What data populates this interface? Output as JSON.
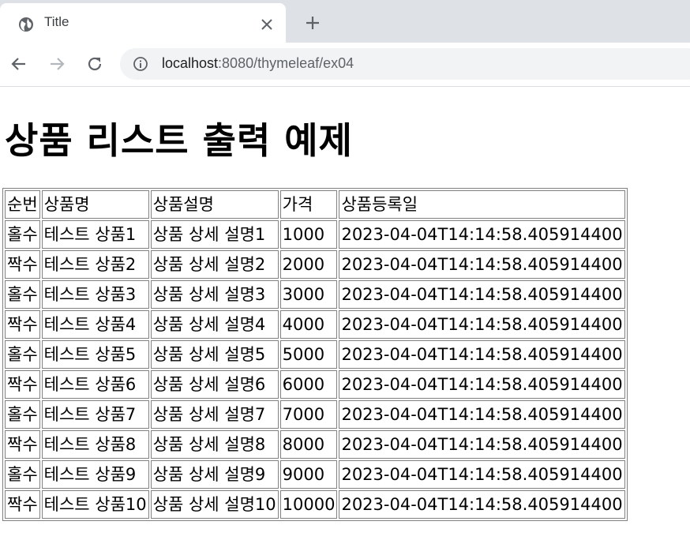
{
  "browser": {
    "tab_title": "Title",
    "url_host": "localhost",
    "url_rest": ":8080/thymeleaf/ex04"
  },
  "page": {
    "heading": "상품 리스트 출력 예제",
    "table": {
      "headers": [
        "순번",
        "상품명",
        "상품설명",
        "가격",
        "상품등록일"
      ],
      "rows": [
        [
          "홀수",
          "테스트 상품1",
          "상품 상세 설명1",
          "1000",
          "2023-04-04T14:14:58.405914400"
        ],
        [
          "짝수",
          "테스트 상품2",
          "상품 상세 설명2",
          "2000",
          "2023-04-04T14:14:58.405914400"
        ],
        [
          "홀수",
          "테스트 상품3",
          "상품 상세 설명3",
          "3000",
          "2023-04-04T14:14:58.405914400"
        ],
        [
          "짝수",
          "테스트 상품4",
          "상품 상세 설명4",
          "4000",
          "2023-04-04T14:14:58.405914400"
        ],
        [
          "홀수",
          "테스트 상품5",
          "상품 상세 설명5",
          "5000",
          "2023-04-04T14:14:58.405914400"
        ],
        [
          "짝수",
          "테스트 상품6",
          "상품 상세 설명6",
          "6000",
          "2023-04-04T14:14:58.405914400"
        ],
        [
          "홀수",
          "테스트 상품7",
          "상품 상세 설명7",
          "7000",
          "2023-04-04T14:14:58.405914400"
        ],
        [
          "짝수",
          "테스트 상품8",
          "상품 상세 설명8",
          "8000",
          "2023-04-04T14:14:58.405914400"
        ],
        [
          "홀수",
          "테스트 상품9",
          "상품 상세 설명9",
          "9000",
          "2023-04-04T14:14:58.405914400"
        ],
        [
          "짝수",
          "테스트 상품10",
          "상품 상세 설명10",
          "10000",
          "2023-04-04T14:14:58.405914400"
        ]
      ]
    }
  },
  "icons": {
    "favicon": "globe-icon",
    "close": "close-icon",
    "new_tab": "plus-icon",
    "back": "back-arrow-icon",
    "forward": "forward-arrow-icon",
    "reload": "reload-icon",
    "site_info": "info-icon"
  }
}
